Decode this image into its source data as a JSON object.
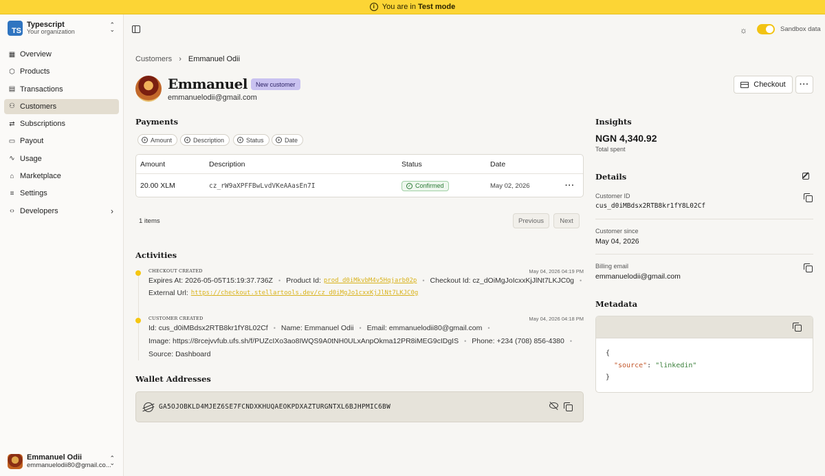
{
  "banner": {
    "prefix": "You are in",
    "mode": "Test mode"
  },
  "org": {
    "logo": "TS",
    "name": "Typescript",
    "subtitle": "Your organization"
  },
  "nav": [
    {
      "label": "Overview",
      "icon": "grid-icon",
      "glyph": "▦",
      "active": false
    },
    {
      "label": "Products",
      "icon": "box-icon",
      "glyph": "⬡",
      "active": false
    },
    {
      "label": "Transactions",
      "icon": "receipt-icon",
      "glyph": "▤",
      "active": false
    },
    {
      "label": "Customers",
      "icon": "users-icon",
      "glyph": "⚇",
      "active": true
    },
    {
      "label": "Subscriptions",
      "icon": "repeat-icon",
      "glyph": "⇄",
      "active": false
    },
    {
      "label": "Payout",
      "icon": "wallet-icon",
      "glyph": "▭",
      "active": false
    },
    {
      "label": "Usage",
      "icon": "activity-icon",
      "glyph": "∿",
      "active": false
    },
    {
      "label": "Marketplace",
      "icon": "store-icon",
      "glyph": "⌂",
      "active": false
    },
    {
      "label": "Settings",
      "icon": "sliders-icon",
      "glyph": "≡",
      "active": false
    },
    {
      "label": "Developers",
      "icon": "code-icon",
      "glyph": "‹›",
      "active": false,
      "chevron": "›"
    }
  ],
  "user": {
    "name": "Emmanuel Odii",
    "email": "emmanuelodii80@gmail.co..."
  },
  "topbar": {
    "sandbox_label": "Sandbox data",
    "sandbox_on": true
  },
  "breadcrumb": {
    "parent": "Customers",
    "separator": "›",
    "current": "Emmanuel Odii"
  },
  "customer": {
    "name": "Emmanuel Odii",
    "badge": "New customer",
    "email": "emmanuelodii@gmail.com"
  },
  "actions": {
    "checkout": "Checkout",
    "more": "···"
  },
  "payments": {
    "title": "Payments",
    "filters": [
      "Amount",
      "Description",
      "Status",
      "Date"
    ],
    "columns": [
      "Amount",
      "Description",
      "Status",
      "Date"
    ],
    "rows": [
      {
        "amount": "20.00 XLM",
        "description": "cz_rW9aXPFFBwLvdVKeAAasEn7I",
        "status": "Confirmed",
        "date": "May 02, 2026",
        "more": "···"
      }
    ],
    "count": "1 items",
    "prev": "Previous",
    "next": "Next"
  },
  "activities": {
    "title": "Activities",
    "items": [
      {
        "title": "CHECKOUT CREATED",
        "time": "May 04, 2026 04:19 PM",
        "expires": "Expires At: 2026-05-05T15:19:37.736Z",
        "product_label": "Product Id:",
        "product_link": "prod_d0iMkvbM4v5Hqjarb02p",
        "checkout_id": "Checkout Id: cz_dOiMgJoIcxxKjJlNt7LKJC0g",
        "url_label": "External Url:",
        "url_link": "https://checkout.stellartools.dev/cz_d0iMgJo1cxxKjJlNt7LKJC0g"
      },
      {
        "title": "CUSTOMER CREATED",
        "time": "May 04, 2026 04:18 PM",
        "id": "Id: cus_d0iMBdsx2RTB8kr1fY8L02Cf",
        "name": "Name: Emmanuel Odii",
        "email": "Email: emmanuelodii80@gmail.com",
        "image": "Image: https://8rcejvvfub.ufs.sh/f/PUZcIXo3ao8IWQS9A0tNH0ULxAnpOkma12PR8iMEG9cIDgIS",
        "phone": "Phone: +234 (708) 856-4380",
        "source": "Source: Dashboard"
      }
    ]
  },
  "wallet": {
    "title": "Wallet Addresses",
    "address": "GA5OJOBKLD4MJEZ6SE7FCNDXKHUQAEOKPDXAZTURGNTXL6BJHPMIC6BW"
  },
  "insights": {
    "title": "Insights",
    "value": "NGN 4,340.92",
    "label": "Total spent"
  },
  "details": {
    "title": "Details",
    "customer_id_label": "Customer ID",
    "customer_id": "cus_d0iMBdsx2RTB8kr1fY8L02Cf",
    "since_label": "Customer since",
    "since": "May 04, 2026",
    "billing_label": "Billing email",
    "billing": "emmanuelodii@gmail.com"
  },
  "metadata": {
    "title": "Metadata",
    "open": "{",
    "key": "\"source\"",
    "colon": ": ",
    "value": "\"linkedin\"",
    "close": "}"
  }
}
